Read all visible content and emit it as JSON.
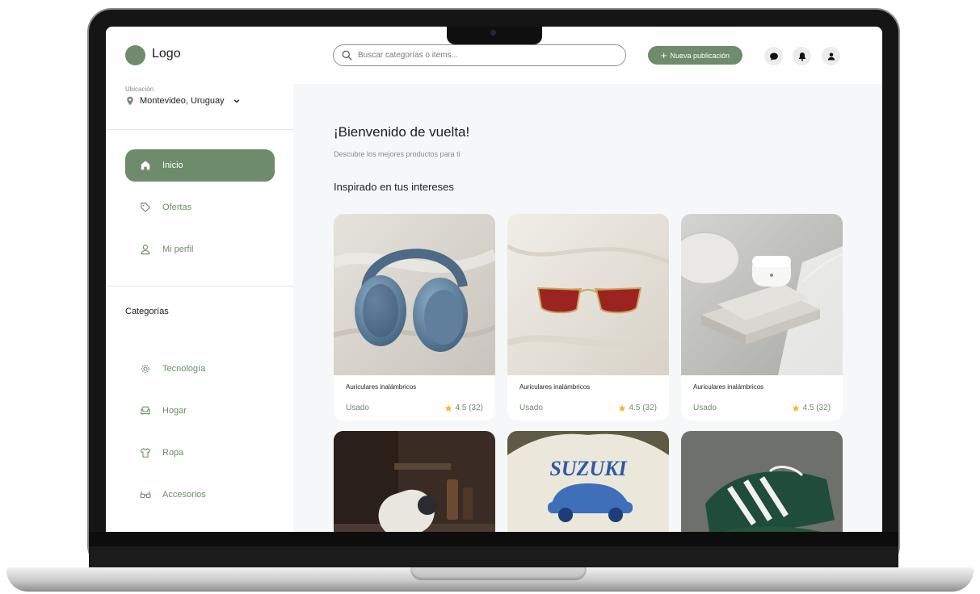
{
  "header": {
    "logo_text": "Logo",
    "search_placeholder": "Buscar categorías o items...",
    "new_post_label": "Nueva publicación"
  },
  "sidebar": {
    "location_label": "Ubicación",
    "location_value": "Montevideo, Uruguay",
    "nav": [
      {
        "label": "Inicio",
        "icon": "home-icon",
        "active": true
      },
      {
        "label": "Ofertas",
        "icon": "tag-icon",
        "active": false
      },
      {
        "label": "Mi perfil",
        "icon": "user-icon",
        "active": false
      }
    ],
    "categories_title": "Categorías",
    "categories": [
      {
        "label": "Tecnología",
        "icon": "gear-icon"
      },
      {
        "label": "Hogar",
        "icon": "armchair-icon"
      },
      {
        "label": "Ropa",
        "icon": "shirt-icon"
      },
      {
        "label": "Accesorios",
        "icon": "glasses-icon"
      }
    ]
  },
  "main": {
    "welcome": "¡Bienvenido de vuelta!",
    "subtitle": "Descubre los mejores productos para ti",
    "section_title": "Inspirado en tus intereses",
    "products": [
      {
        "name": "Auriculares inalámbricos",
        "condition": "Usado",
        "rating": "4.5 (32)"
      },
      {
        "name": "Auriculares inalámbricos",
        "condition": "Usado",
        "rating": "4.5 (32)"
      },
      {
        "name": "Auriculares inalámbricos",
        "condition": "Usado",
        "rating": "4.5 (32)"
      }
    ],
    "second_row_texts": {
      "shirt_print": "SUZUKI"
    }
  },
  "colors": {
    "accent": "#6e8b6b",
    "star": "#f5b82e",
    "main_bg": "#f6f7f8"
  }
}
